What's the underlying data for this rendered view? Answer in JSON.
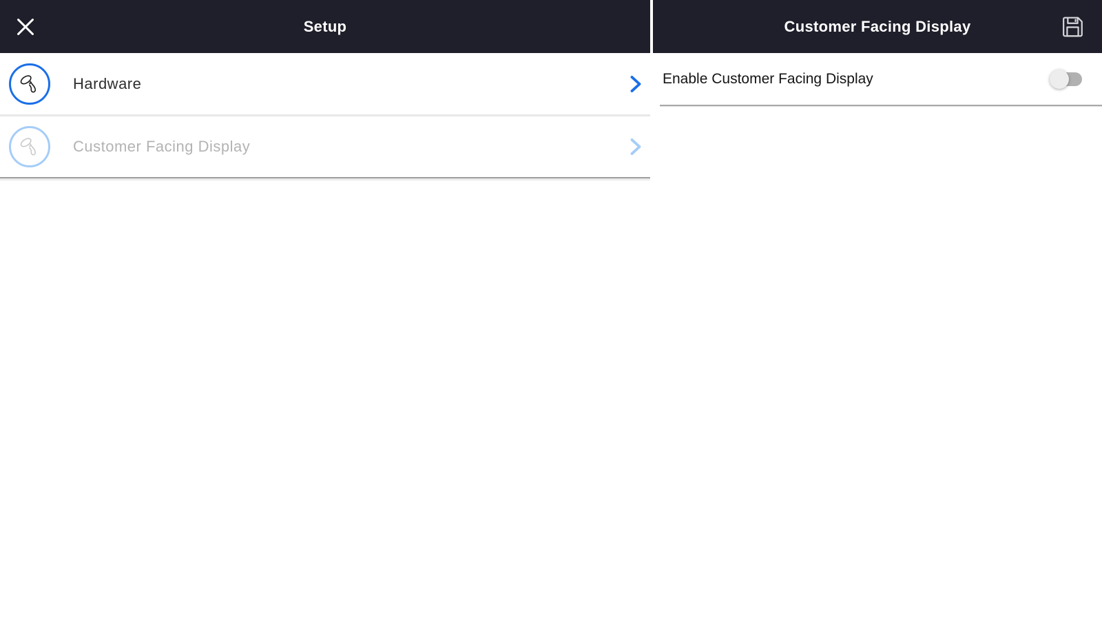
{
  "left_panel": {
    "header": {
      "title": "Setup"
    },
    "menu_items": [
      {
        "label": "Hardware",
        "icon": "barcode-scanner-icon",
        "enabled": true
      },
      {
        "label": "Customer Facing Display",
        "icon": "barcode-scanner-icon",
        "enabled": false
      }
    ]
  },
  "right_panel": {
    "header": {
      "title": "Customer Facing Display",
      "action_icon": "save-icon"
    },
    "settings": [
      {
        "label": "Enable Customer Facing Display",
        "control": "toggle",
        "state": "off"
      }
    ]
  },
  "icons": {
    "close": "close-icon",
    "save": "save-icon",
    "menu": "barcode-scanner-icon",
    "chevron": "chevron-right-icon"
  },
  "colors": {
    "header_background": "#1F1F2B",
    "accent_blue": "#1A6FE8",
    "disabled_blue": "#A5CDF8",
    "disabled_text": "#B3B3B3",
    "primary_text": "#2E2E2E",
    "row_divider": "#E8E8E8",
    "section_border": "#9E9E9E",
    "toggle_track": "#B1B1B1",
    "toggle_thumb": "#EDEDED"
  }
}
